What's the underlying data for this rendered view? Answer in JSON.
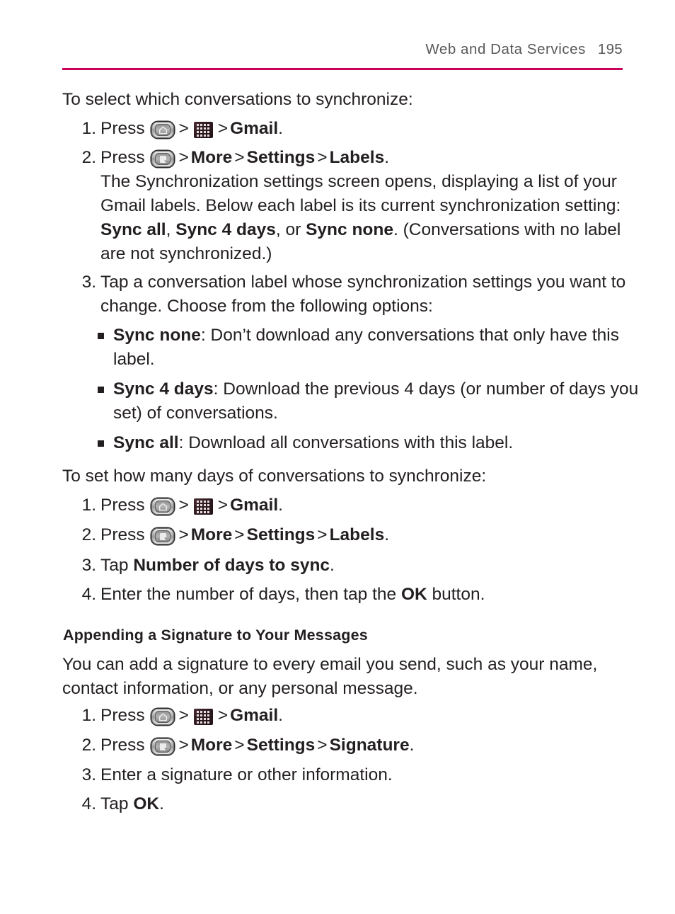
{
  "header": {
    "title": "Web and Data Services",
    "page_number": "195",
    "rule_color": "#c8005a",
    "text_color": "#59595b"
  },
  "icons": {
    "home_key": "home-key-icon",
    "menu_key": "menu-key-icon",
    "apps_grid": "apps-launcher-icon",
    "separator": ">",
    "bullet": "square-bullet-icon"
  },
  "sections": [
    {
      "heading": "To select which conversations to synchronize:",
      "steps": [
        {
          "number": "1.",
          "parts": [
            {
              "type": "text",
              "value": "Press "
            },
            {
              "type": "icon",
              "value": "home-key-icon"
            },
            {
              "type": "sep",
              "value": ">"
            },
            {
              "type": "icon",
              "value": "apps-launcher-icon"
            },
            {
              "type": "sep",
              "value": ">"
            },
            {
              "type": "bold",
              "value": "Gmail"
            },
            {
              "type": "text",
              "value": "."
            }
          ]
        },
        {
          "number": "2.",
          "parts": [
            {
              "type": "text",
              "value": "Press "
            },
            {
              "type": "icon",
              "value": "menu-key-icon"
            },
            {
              "type": "sep",
              "value": ">"
            },
            {
              "type": "bold",
              "value": "More"
            },
            {
              "type": "sep",
              "value": ">"
            },
            {
              "type": "bold",
              "value": "Settings"
            },
            {
              "type": "sep",
              "value": ">"
            },
            {
              "type": "bold",
              "value": "Labels"
            },
            {
              "type": "text",
              "value": "."
            }
          ],
          "continuation": [
            {
              "type": "text",
              "value": "The Synchronization settings screen opens, displaying a list of your Gmail labels. Below each label is its current synchronization setting: "
            },
            {
              "type": "bold",
              "value": "Sync all"
            },
            {
              "type": "text",
              "value": ", "
            },
            {
              "type": "bold",
              "value": "Sync 4 days"
            },
            {
              "type": "text",
              "value": ", or "
            },
            {
              "type": "bold",
              "value": "Sync none"
            },
            {
              "type": "text",
              "value": ". (Conversations with no label are not synchronized.)"
            }
          ]
        },
        {
          "number": "3.",
          "parts": [
            {
              "type": "text",
              "value": "Tap a conversation label whose synchronization settings you want to change. Choose from the following options:"
            }
          ]
        }
      ],
      "bullets": [
        {
          "parts": [
            {
              "type": "bold",
              "value": "Sync none"
            },
            {
              "type": "text",
              "value": ": Don’t download any conversations that only have this label."
            }
          ]
        },
        {
          "parts": [
            {
              "type": "bold",
              "value": "Sync 4 days"
            },
            {
              "type": "text",
              "value": ": Download the previous 4 days (or number of days you set) of conversations."
            }
          ]
        },
        {
          "parts": [
            {
              "type": "bold",
              "value": "Sync all"
            },
            {
              "type": "text",
              "value": ": Download all conversations with this label."
            }
          ]
        }
      ]
    },
    {
      "heading": "To set how many days of conversations to synchronize:",
      "steps": [
        {
          "number": "1.",
          "parts": [
            {
              "type": "text",
              "value": "Press "
            },
            {
              "type": "icon",
              "value": "home-key-icon"
            },
            {
              "type": "sep",
              "value": ">"
            },
            {
              "type": "icon",
              "value": "apps-launcher-icon"
            },
            {
              "type": "sep",
              "value": ">"
            },
            {
              "type": "bold",
              "value": "Gmail"
            },
            {
              "type": "text",
              "value": "."
            }
          ]
        },
        {
          "number": "2.",
          "parts": [
            {
              "type": "text",
              "value": "Press "
            },
            {
              "type": "icon",
              "value": "menu-key-icon"
            },
            {
              "type": "sep",
              "value": ">"
            },
            {
              "type": "bold",
              "value": "More"
            },
            {
              "type": "sep",
              "value": ">"
            },
            {
              "type": "bold",
              "value": "Settings"
            },
            {
              "type": "sep",
              "value": ">"
            },
            {
              "type": "bold",
              "value": "Labels"
            },
            {
              "type": "text",
              "value": "."
            }
          ]
        },
        {
          "number": "3.",
          "parts": [
            {
              "type": "text",
              "value": "Tap "
            },
            {
              "type": "bold",
              "value": "Number of days to sync"
            },
            {
              "type": "text",
              "value": "."
            }
          ]
        },
        {
          "number": "4.",
          "parts": [
            {
              "type": "text",
              "value": "Enter the number of days, then tap the "
            },
            {
              "type": "bold",
              "value": "OK"
            },
            {
              "type": "text",
              "value": " button."
            }
          ]
        }
      ]
    },
    {
      "subheading": "Appending a Signature to Your Messages",
      "paragraph": "You can add a signature to every email you send, such as your name, contact information, or any personal message.",
      "steps": [
        {
          "number": "1.",
          "parts": [
            {
              "type": "text",
              "value": "Press "
            },
            {
              "type": "icon",
              "value": "home-key-icon"
            },
            {
              "type": "sep",
              "value": ">"
            },
            {
              "type": "icon",
              "value": "apps-launcher-icon"
            },
            {
              "type": "sep",
              "value": ">"
            },
            {
              "type": "bold",
              "value": "Gmail"
            },
            {
              "type": "text",
              "value": "."
            }
          ]
        },
        {
          "number": "2.",
          "parts": [
            {
              "type": "text",
              "value": "Press "
            },
            {
              "type": "icon",
              "value": "menu-key-icon"
            },
            {
              "type": "sep",
              "value": ">"
            },
            {
              "type": "bold",
              "value": "More"
            },
            {
              "type": "sep",
              "value": ">"
            },
            {
              "type": "bold",
              "value": "Settings"
            },
            {
              "type": "sep",
              "value": ">"
            },
            {
              "type": "bold",
              "value": "Signature"
            },
            {
              "type": "text",
              "value": "."
            }
          ]
        },
        {
          "number": "3.",
          "parts": [
            {
              "type": "text",
              "value": "Enter a signature or other information."
            }
          ]
        },
        {
          "number": "4.",
          "parts": [
            {
              "type": "text",
              "value": "Tap "
            },
            {
              "type": "bold",
              "value": "OK"
            },
            {
              "type": "text",
              "value": "."
            }
          ]
        }
      ]
    }
  ]
}
